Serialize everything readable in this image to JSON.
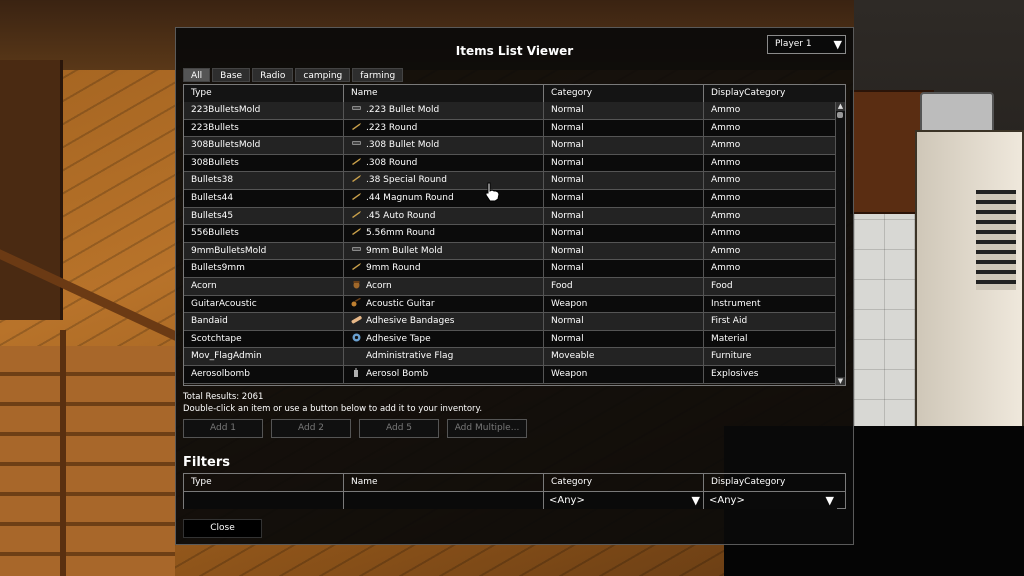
{
  "window": {
    "title": "Items List Viewer"
  },
  "player_select": {
    "value": "Player 1"
  },
  "tabs": [
    {
      "label": "All",
      "active": true
    },
    {
      "label": "Base",
      "active": false
    },
    {
      "label": "Radio",
      "active": false
    },
    {
      "label": "camping",
      "active": false
    },
    {
      "label": "farming",
      "active": false
    }
  ],
  "table": {
    "headers": [
      "Type",
      "Name",
      "Category",
      "DisplayCategory"
    ],
    "rows": [
      {
        "type": "223BulletsMold",
        "icon": "mold-icon",
        "name": ".223 Bullet Mold",
        "category": "Normal",
        "display": "Ammo"
      },
      {
        "type": "223Bullets",
        "icon": "bullet-icon",
        "name": ".223 Round",
        "category": "Normal",
        "display": "Ammo"
      },
      {
        "type": "308BulletsMold",
        "icon": "mold-icon",
        "name": ".308 Bullet Mold",
        "category": "Normal",
        "display": "Ammo"
      },
      {
        "type": "308Bullets",
        "icon": "bullet-icon",
        "name": ".308 Round",
        "category": "Normal",
        "display": "Ammo"
      },
      {
        "type": "Bullets38",
        "icon": "bullet-icon",
        "name": ".38 Special Round",
        "category": "Normal",
        "display": "Ammo"
      },
      {
        "type": "Bullets44",
        "icon": "bullet-icon",
        "name": ".44 Magnum Round",
        "category": "Normal",
        "display": "Ammo"
      },
      {
        "type": "Bullets45",
        "icon": "bullet-icon",
        "name": ".45 Auto Round",
        "category": "Normal",
        "display": "Ammo"
      },
      {
        "type": "556Bullets",
        "icon": "bullet-icon",
        "name": "5.56mm Round",
        "category": "Normal",
        "display": "Ammo"
      },
      {
        "type": "9mmBulletsMold",
        "icon": "mold-icon",
        "name": "9mm Bullet Mold",
        "category": "Normal",
        "display": "Ammo"
      },
      {
        "type": "Bullets9mm",
        "icon": "bullet-icon",
        "name": "9mm Round",
        "category": "Normal",
        "display": "Ammo"
      },
      {
        "type": "Acorn",
        "icon": "acorn-icon",
        "name": "Acorn",
        "category": "Food",
        "display": "Food"
      },
      {
        "type": "GuitarAcoustic",
        "icon": "guitar-icon",
        "name": "Acoustic Guitar",
        "category": "Weapon",
        "display": "Instrument"
      },
      {
        "type": "Bandaid",
        "icon": "bandage-icon",
        "name": "Adhesive Bandages",
        "category": "Normal",
        "display": "First Aid"
      },
      {
        "type": "Scotchtape",
        "icon": "tape-icon",
        "name": "Adhesive Tape",
        "category": "Normal",
        "display": "Material"
      },
      {
        "type": "Mov_FlagAdmin",
        "icon": "",
        "name": "Administrative Flag",
        "category": "Moveable",
        "display": "Furniture"
      },
      {
        "type": "Aerosolbomb",
        "icon": "aerosol-icon",
        "name": "Aerosol Bomb",
        "category": "Weapon",
        "display": "Explosives"
      }
    ]
  },
  "total_results": "Total Results: 2061",
  "hint": "Double-click an item or use a button below to add it to your inventory.",
  "buttons": {
    "add1": "Add 1",
    "add2": "Add 2",
    "add5": "Add 5",
    "add_multiple": "Add Multiple..."
  },
  "filters": {
    "title": "Filters",
    "headers": [
      "Type",
      "Name",
      "Category",
      "DisplayCategory"
    ],
    "category_value": "<Any>",
    "display_category_value": "<Any>"
  },
  "close_label": "Close"
}
